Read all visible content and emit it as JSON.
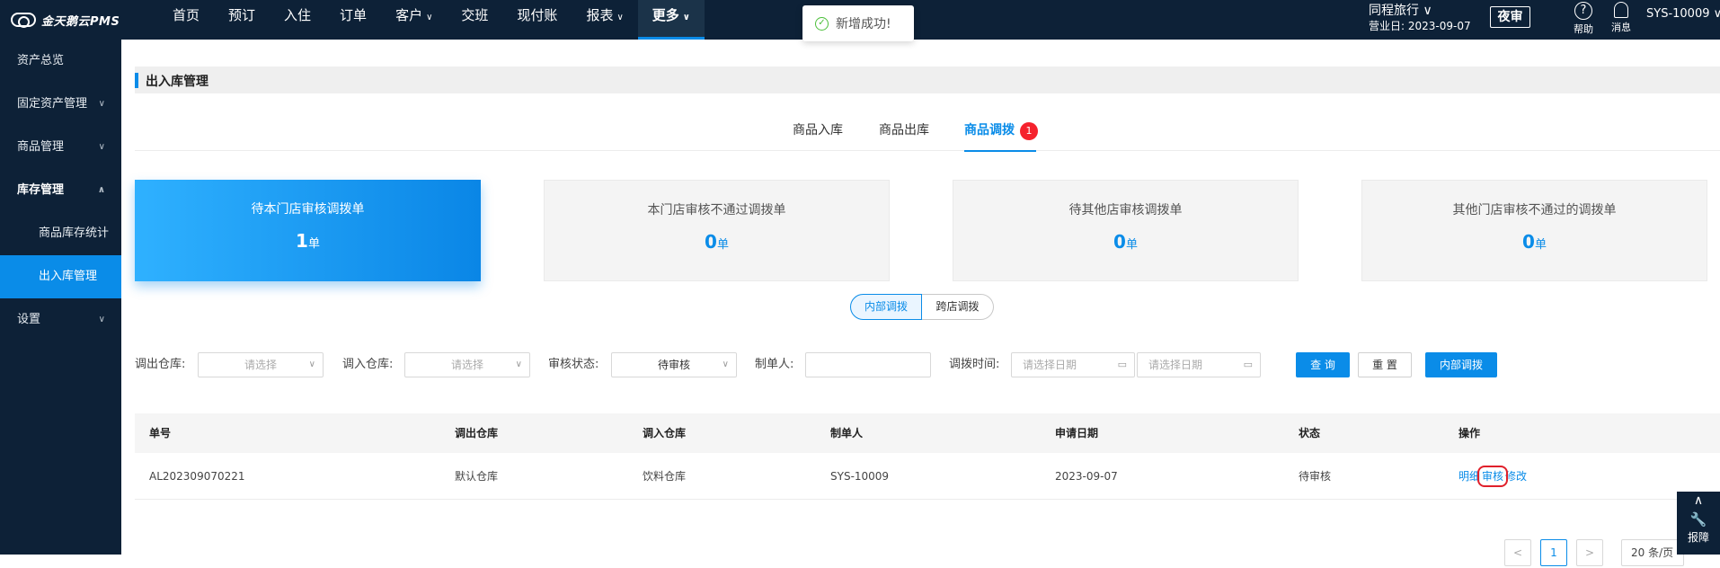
{
  "app": {
    "logo_text": "金天鹅云PMS"
  },
  "nav": [
    {
      "label": "首页",
      "caret": ""
    },
    {
      "label": "预订",
      "caret": ""
    },
    {
      "label": "入住",
      "caret": ""
    },
    {
      "label": "订单",
      "caret": ""
    },
    {
      "label": "客户",
      "caret": "∨"
    },
    {
      "label": "交班",
      "caret": ""
    },
    {
      "label": "现付账",
      "caret": ""
    },
    {
      "label": "报表",
      "caret": "∨"
    },
    {
      "label": "更多",
      "caret": "∨",
      "active": true
    }
  ],
  "toast": {
    "text": "新增成功!"
  },
  "header": {
    "hotel_name": "同程旅行 ∨",
    "business_date": "营业日: 2023-09-07",
    "night_audit": "夜审",
    "help_label": "帮助",
    "msg_label": "消息",
    "user": "SYS-10009 ∨"
  },
  "sidebar": {
    "items": [
      {
        "label": "资产总览",
        "chev": ""
      },
      {
        "label": "固定资产管理",
        "chev": "∨"
      },
      {
        "label": "商品管理",
        "chev": "∨"
      },
      {
        "label": "库存管理",
        "chev": "∧"
      }
    ],
    "sub": [
      "商品库存统计",
      "出入库管理"
    ],
    "settings": {
      "label": "设置",
      "chev": "∨"
    }
  },
  "page": {
    "title": "出入库管理"
  },
  "tabs": [
    "商品入库",
    "商品出库",
    "商品调拨"
  ],
  "tab_badge": "1",
  "cards": [
    {
      "label": "待本门店审核调拨单",
      "num": "1",
      "unit": "单"
    },
    {
      "label": "本门店审核不通过调拨单",
      "num": "0",
      "unit": "单"
    },
    {
      "label": "待其他店审核调拨单",
      "num": "0",
      "unit": "单"
    },
    {
      "label": "其他门店审核不通过的调拨单",
      "num": "0",
      "unit": "单"
    }
  ],
  "segment": [
    "内部调拨",
    "跨店调拨"
  ],
  "filters": {
    "out_wh_label": "调出仓库:",
    "out_wh_placeholder": "请选择",
    "in_wh_label": "调入仓库:",
    "in_wh_placeholder": "请选择",
    "status_label": "审核状态:",
    "status_value": "待审核",
    "maker_label": "制单人:",
    "maker_value": "",
    "time_label": "调拨时间:",
    "date_start_placeholder": "请选择日期",
    "date_end_placeholder": "请选择日期",
    "query": "查 询",
    "reset": "重 置",
    "internal": "内部调拨"
  },
  "table": {
    "headers": [
      "单号",
      "调出仓库",
      "调入仓库",
      "制单人",
      "申请日期",
      "状态",
      "操作"
    ],
    "rows": [
      {
        "order_no": "AL202309070221",
        "out_wh": "默认仓库",
        "in_wh": "饮料仓库",
        "maker": "SYS-10009",
        "date": "2023-09-07",
        "status": "待审核",
        "ops": [
          "明细",
          "审核",
          "修改"
        ]
      }
    ]
  },
  "pager": {
    "prev": "<",
    "page": "1",
    "next": ">",
    "size": "20 条/页"
  },
  "dock": {
    "up": "∧",
    "label": "报障"
  },
  "colors": {
    "accent": "#0a8ce8",
    "nav_bg": "#0d2137",
    "badge": "#f5222d",
    "highlight": "#e0202b"
  }
}
